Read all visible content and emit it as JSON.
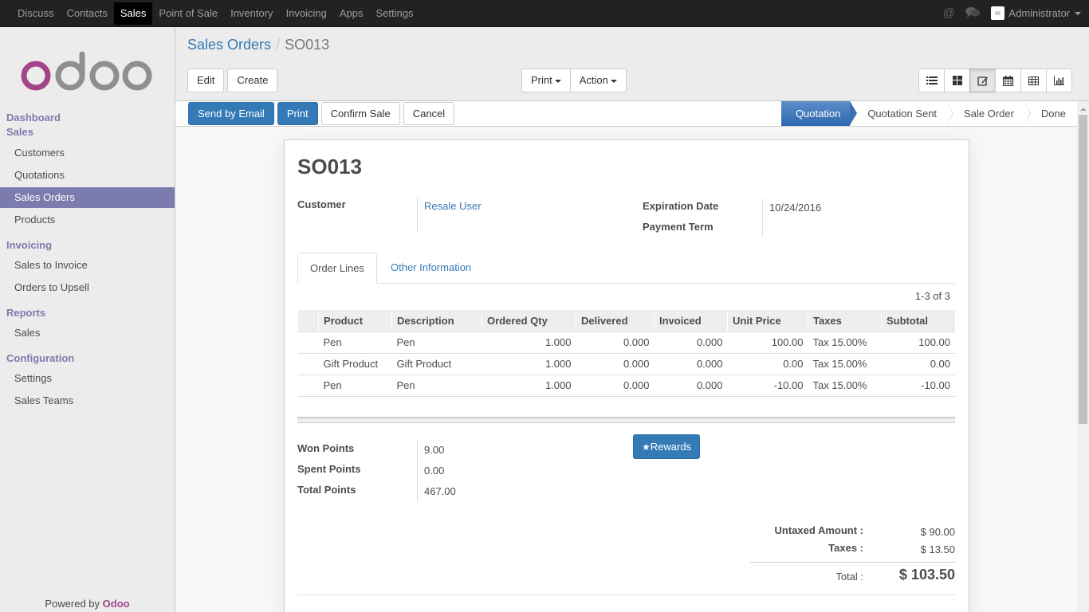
{
  "navbar": {
    "menu": [
      {
        "label": "Discuss",
        "active": false
      },
      {
        "label": "Contacts",
        "active": false
      },
      {
        "label": "Sales",
        "active": true
      },
      {
        "label": "Point of Sale",
        "active": false
      },
      {
        "label": "Inventory",
        "active": false
      },
      {
        "label": "Invoicing",
        "active": false
      },
      {
        "label": "Apps",
        "active": false
      },
      {
        "label": "Settings",
        "active": false
      }
    ],
    "icons": {
      "mention": "@",
      "chat": "💬"
    },
    "user": "Administrator"
  },
  "sidebar": {
    "sections": {
      "dashboard": "Dashboard",
      "sales": "Sales",
      "invoicing": "Invoicing",
      "reports": "Reports",
      "configuration": "Configuration"
    },
    "items": {
      "customers": "Customers",
      "quotations": "Quotations",
      "sales_orders": "Sales Orders",
      "products": "Products",
      "sales_to_invoice": "Sales to Invoice",
      "orders_to_upsell": "Orders to Upsell",
      "reports_sales": "Sales",
      "settings": "Settings",
      "sales_teams": "Sales Teams"
    },
    "powered_by": "Powered by",
    "brand": "Odoo"
  },
  "breadcrumb": {
    "parent": "Sales Orders",
    "current": "SO013"
  },
  "control_panel": {
    "edit": "Edit",
    "create": "Create",
    "print": "Print",
    "action": "Action",
    "views": [
      "list",
      "kanban",
      "form",
      "calendar",
      "pivot",
      "graph"
    ],
    "active_view": "form"
  },
  "statusbar": {
    "buttons": {
      "send_email": "Send by Email",
      "print": "Print",
      "confirm": "Confirm Sale",
      "cancel": "Cancel"
    },
    "stages": [
      "Quotation",
      "Quotation Sent",
      "Sale Order",
      "Done"
    ],
    "active_stage": "Quotation"
  },
  "form": {
    "title": "SO013",
    "customer_label": "Customer",
    "customer": "Resale User",
    "expiration_label": "Expiration Date",
    "expiration": "10/24/2016",
    "payment_term_label": "Payment Term",
    "payment_term": "",
    "tabs": {
      "order_lines": "Order Lines",
      "other_info": "Other Information"
    },
    "pager": "1-3 of 3",
    "columns": [
      "Product",
      "Description",
      "Ordered Qty",
      "Delivered",
      "Invoiced",
      "Unit Price",
      "Taxes",
      "Subtotal"
    ],
    "lines": [
      {
        "product": "Pen",
        "description": "Pen",
        "qty": "1.000",
        "delivered": "0.000",
        "invoiced": "0.000",
        "unit_price": "100.00",
        "taxes": "Tax 15.00%",
        "subtotal": "100.00"
      },
      {
        "product": "Gift Product",
        "description": "Gift Product",
        "qty": "1.000",
        "delivered": "0.000",
        "invoiced": "0.000",
        "unit_price": "0.00",
        "taxes": "Tax 15.00%",
        "subtotal": "0.00"
      },
      {
        "product": "Pen",
        "description": "Pen",
        "qty": "1.000",
        "delivered": "0.000",
        "invoiced": "0.000",
        "unit_price": "-10.00",
        "taxes": "Tax 15.00%",
        "subtotal": "-10.00"
      }
    ],
    "points": {
      "won_label": "Won Points",
      "won": "9.00",
      "spent_label": "Spent Points",
      "spent": "0.00",
      "total_label": "Total Points",
      "total": "467.00"
    },
    "rewards_button": "Rewards",
    "totals": {
      "untaxed_label": "Untaxed Amount :",
      "untaxed": "$ 90.00",
      "taxes_label": "Taxes :",
      "taxes": "$ 13.50",
      "total_label": "Total :",
      "total": "$ 103.50"
    }
  },
  "colors": {
    "brand_purple": "#7c7bad",
    "odoo_magenta": "#a24689",
    "primary_blue": "#337ab7"
  }
}
